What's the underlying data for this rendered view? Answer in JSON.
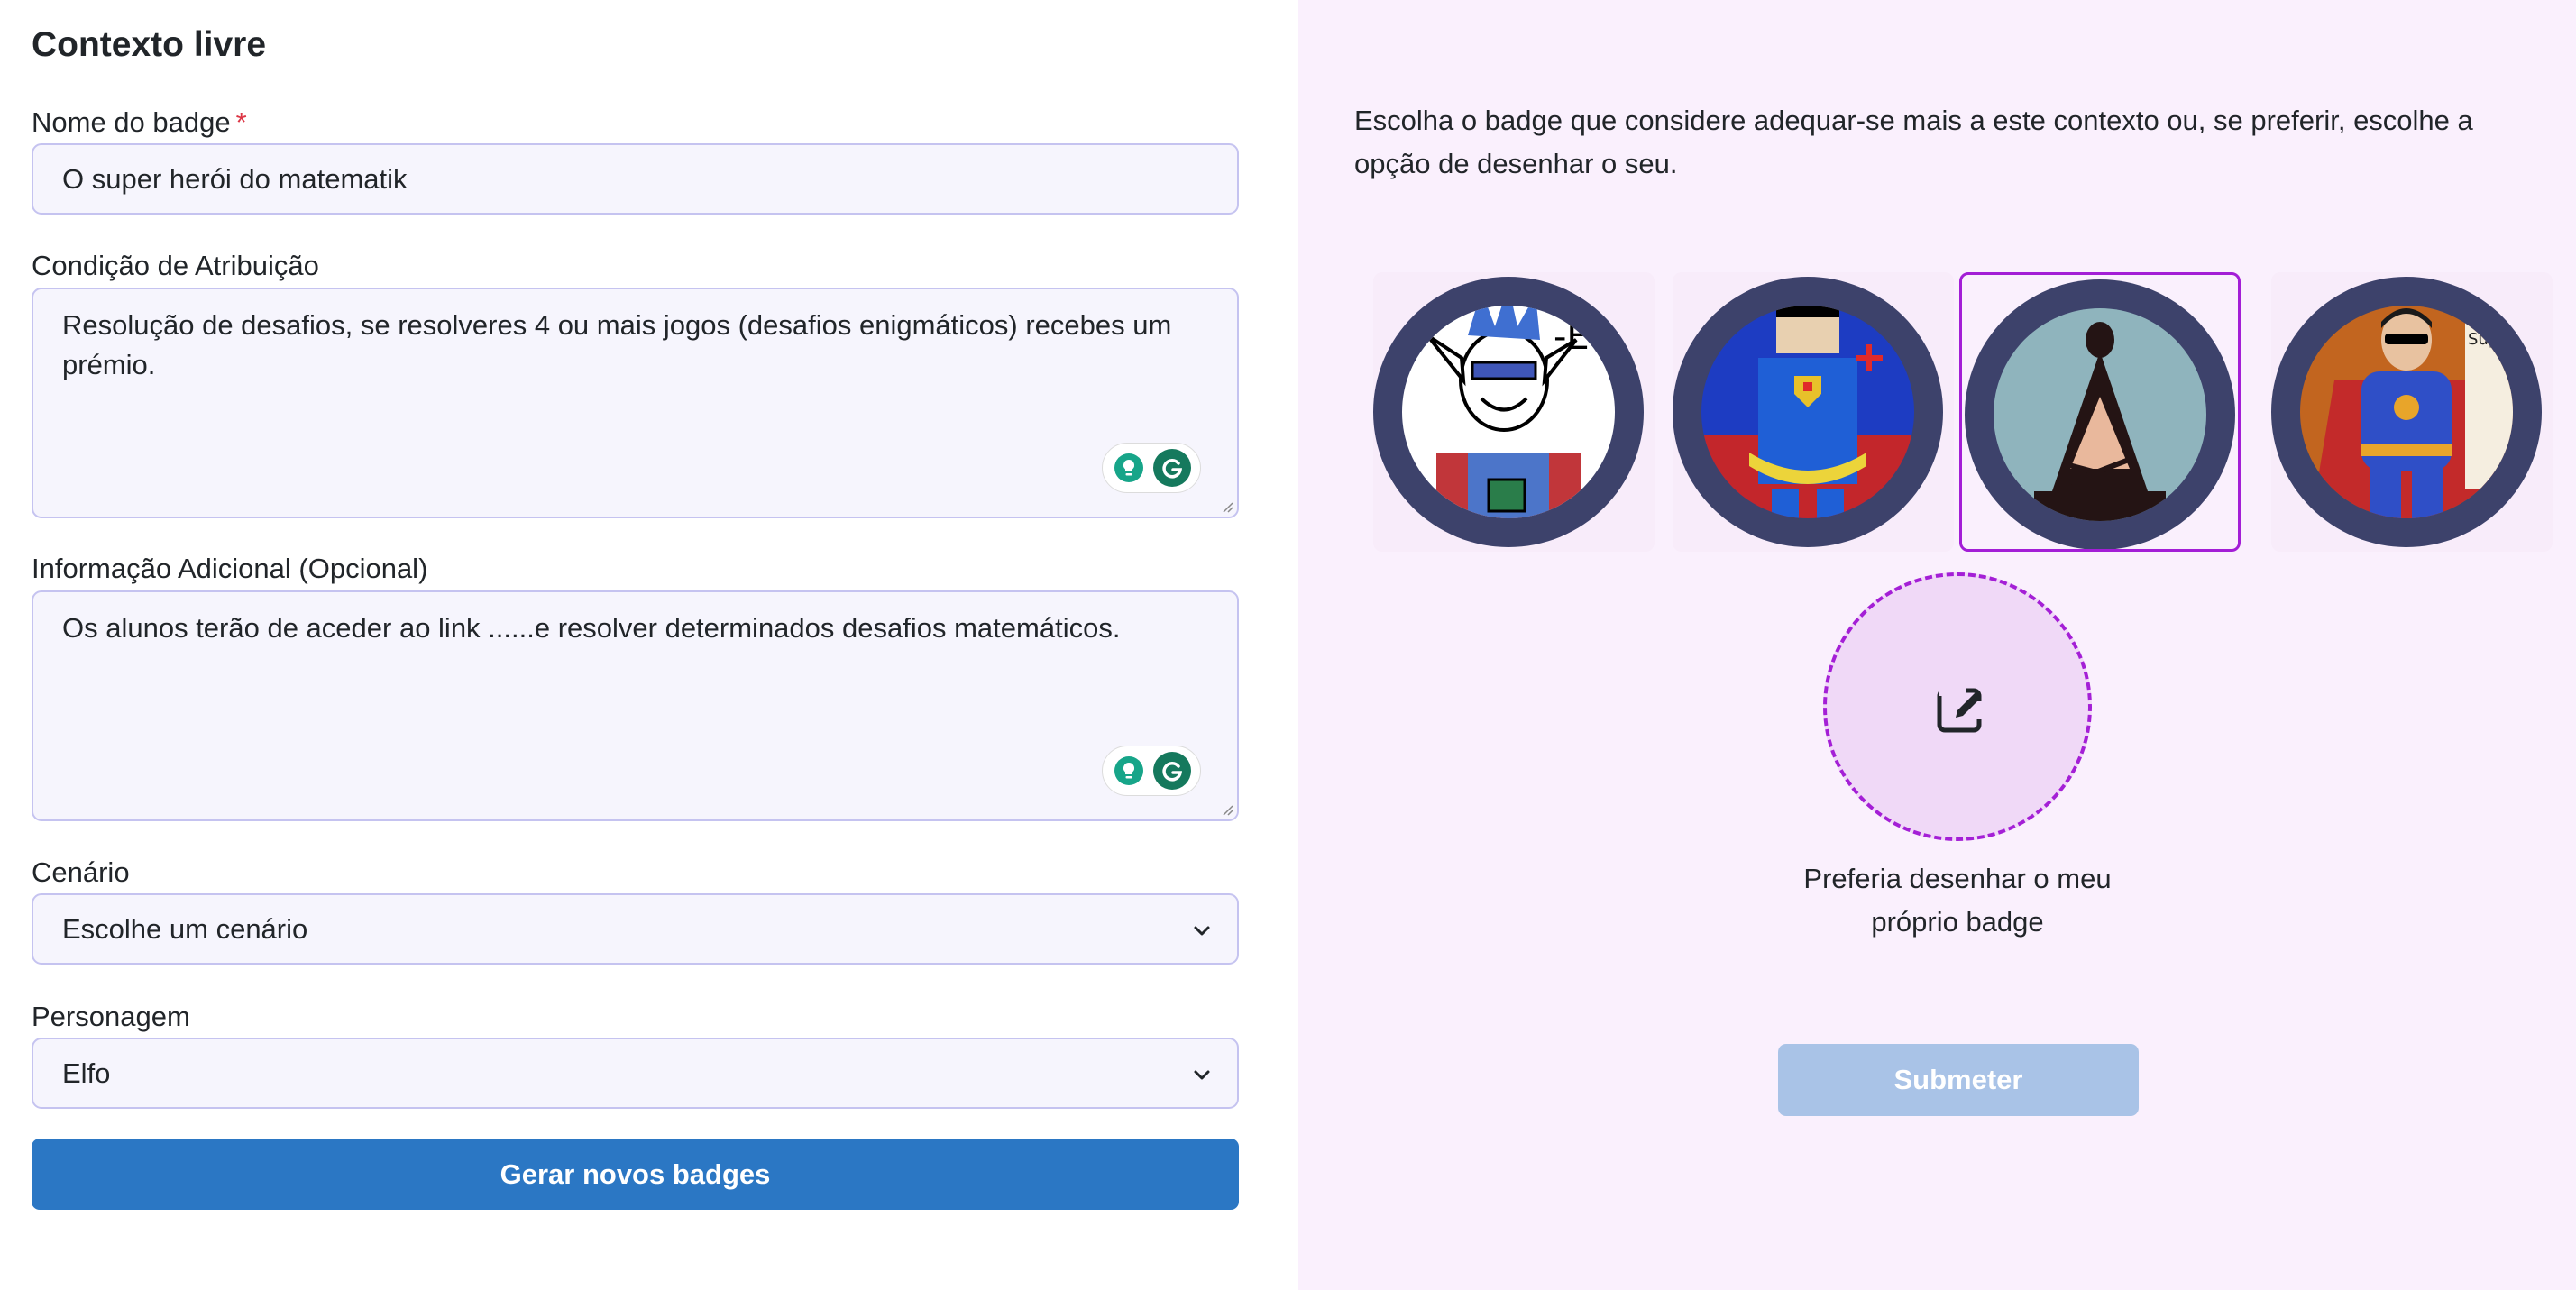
{
  "form": {
    "title": "Contexto livre",
    "name_label": "Nome do badge",
    "required_mark": "*",
    "name_value": "O  super herói do matematik",
    "condition_label": "Condição de Atribuição",
    "condition_value": "Resolução de desafios, se resolveres 4 ou mais jogos (desafios enigmáticos) recebes um prémio.",
    "info_label": "Informação Adicional (Opcional)",
    "info_value": "Os alunos terão de aceder ao link ......e resolver determinados desafios matemáticos.",
    "scenario_label": "Cenário",
    "scenario_value": "Escolhe um cenário",
    "character_label": "Personagem",
    "character_value": "Elfo",
    "generate_button": "Gerar novos badges"
  },
  "badges": {
    "intro": "Escolha o badge que considere adequar-se mais a este contexto ou, se preferir, escolhe a opção de desenhar o seu.",
    "items": [
      {
        "name": "elf-hero-badge",
        "selected": false
      },
      {
        "name": "pixel-hero-badge",
        "selected": false
      },
      {
        "name": "meditating-figure-badge",
        "selected": true
      },
      {
        "name": "caped-hero-badge",
        "selected": false
      }
    ],
    "draw_option": "Preferia desenhar o meu próprio badge",
    "submit_button": "Submeter"
  },
  "colors": {
    "primary": "#2b77c4",
    "submit_disabled": "#a9c3e7",
    "selection": "#a31ed6",
    "right_panel_bg": "#faf0fd",
    "badge_ring": "#3d426b"
  }
}
